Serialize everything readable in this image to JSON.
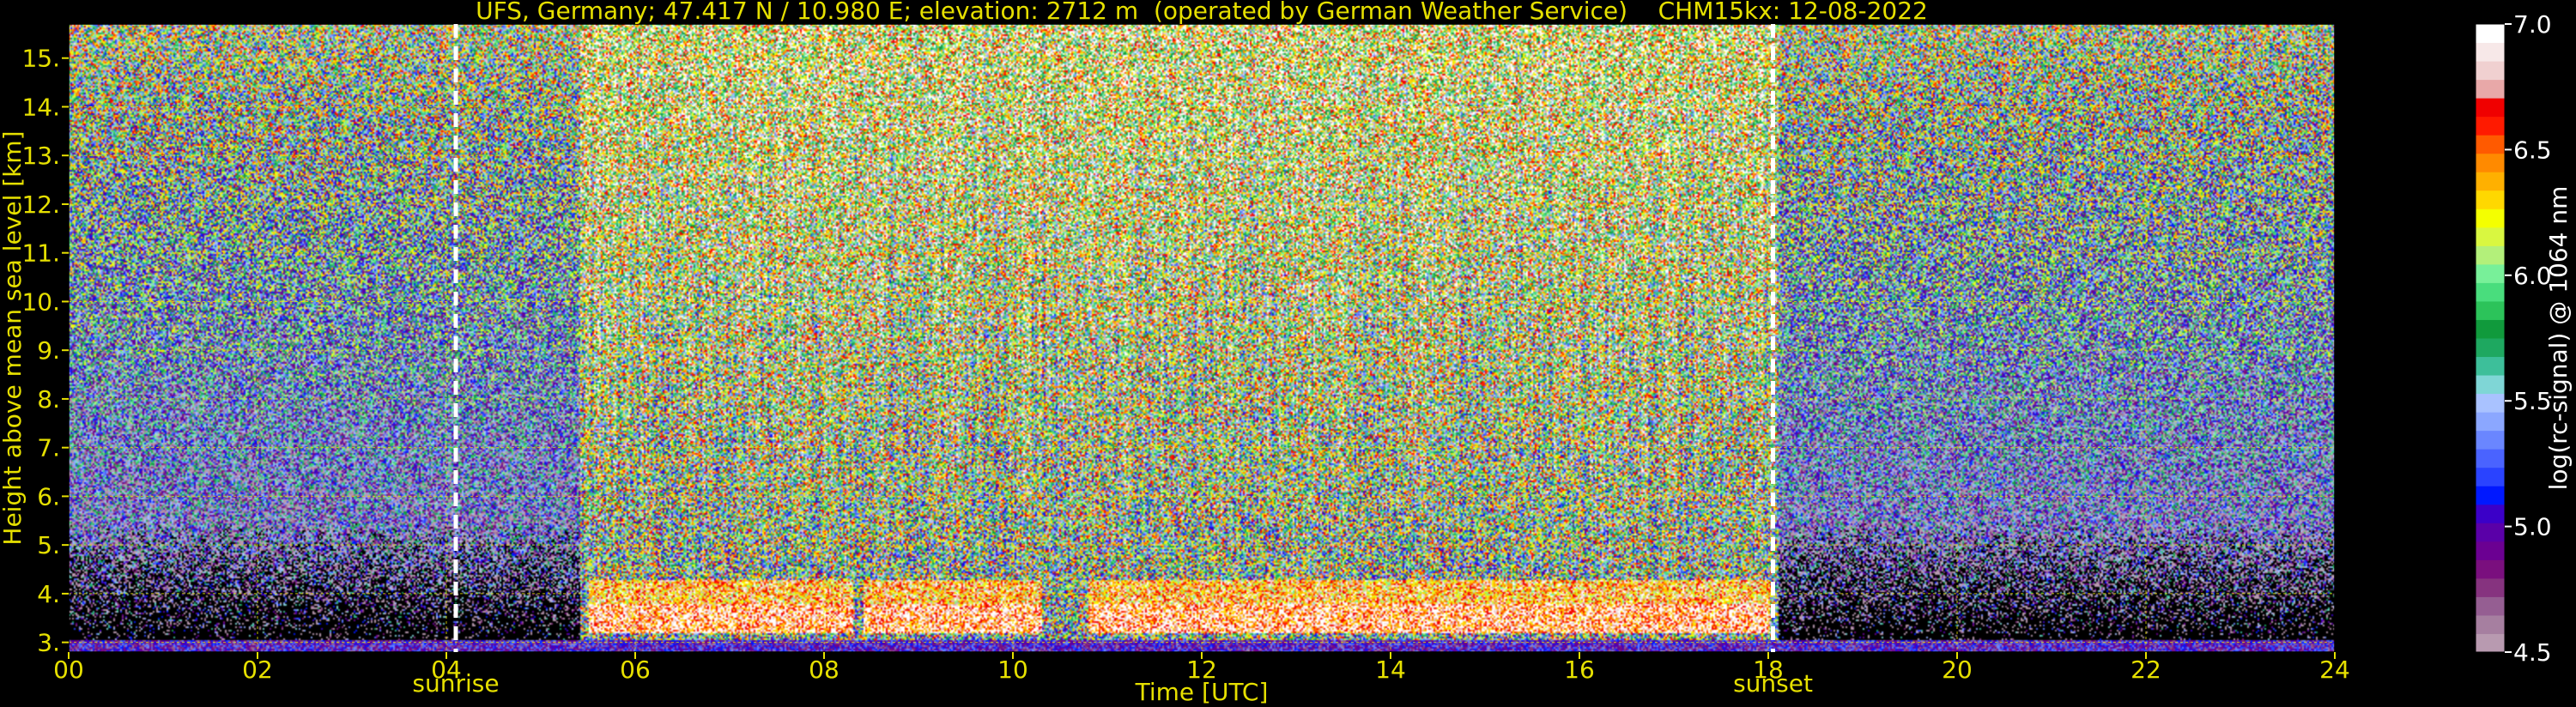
{
  "chart_data": {
    "type": "heatmap",
    "title": "UFS, Germany; 47.417 N / 10.980 E; elevation: 2712 m  (operated by German Weather Service)    CHM15kx: 12-08-2022",
    "xlabel": "Time [UTC]",
    "ylabel": "Height above mean sea level [km]",
    "xlim": [
      0,
      24
    ],
    "ylim": [
      2.8,
      15.7
    ],
    "x_ticks": [
      0,
      2,
      4,
      6,
      8,
      10,
      12,
      14,
      16,
      18,
      20,
      22,
      24
    ],
    "x_tick_labels": [
      "00",
      "02",
      "04",
      "06",
      "08",
      "10",
      "12",
      "14",
      "16",
      "18",
      "20",
      "22",
      "24"
    ],
    "y_ticks": [
      3,
      4,
      5,
      6,
      7,
      8,
      9,
      10,
      11,
      12,
      13,
      14,
      15
    ],
    "y_tick_labels": [
      "3.",
      "4.",
      "5.",
      "6.",
      "7.",
      "8.",
      "9.",
      "10.",
      "11.",
      "12.",
      "13.",
      "14.",
      "15."
    ],
    "grid": true,
    "colorbar": {
      "label": "log(rc-signal) @ 1064 nm",
      "range": [
        4.5,
        7.0
      ],
      "ticks": [
        4.5,
        5.0,
        5.5,
        6.0,
        6.5,
        7.0
      ],
      "tick_labels": [
        "4.5",
        "5.0",
        "5.5",
        "6.0",
        "6.5",
        "7.0"
      ],
      "colors": [
        "#b89ab0",
        "#a67fa0",
        "#955e92",
        "#86337f",
        "#7a0f7e",
        "#6b0092",
        "#5a00a8",
        "#3b00c8",
        "#0018ff",
        "#2a43ff",
        "#4a63ff",
        "#6a86ff",
        "#8ba7ff",
        "#a9c2ff",
        "#7fd6d6",
        "#3dbf9a",
        "#1ea860",
        "#109a3c",
        "#2cc35a",
        "#49dd7d",
        "#78f099",
        "#b3f07a",
        "#d9f740",
        "#f4ff00",
        "#ffd800",
        "#ffb000",
        "#ff8a00",
        "#ff5a00",
        "#ff1a00",
        "#f00000",
        "#e8a8a8",
        "#f0d0d0",
        "#f7e8e8",
        "#ffffff"
      ]
    },
    "events": [
      {
        "time": 4.1,
        "label": "sunrise"
      },
      {
        "time": 18.05,
        "label": "sunset"
      }
    ],
    "cloud_layer_km": [
      3.2,
      4.3
    ],
    "cloud_periods_utc": [
      [
        5.5,
        8.3
      ],
      [
        8.4,
        10.3
      ],
      [
        10.8,
        18.0
      ]
    ]
  }
}
